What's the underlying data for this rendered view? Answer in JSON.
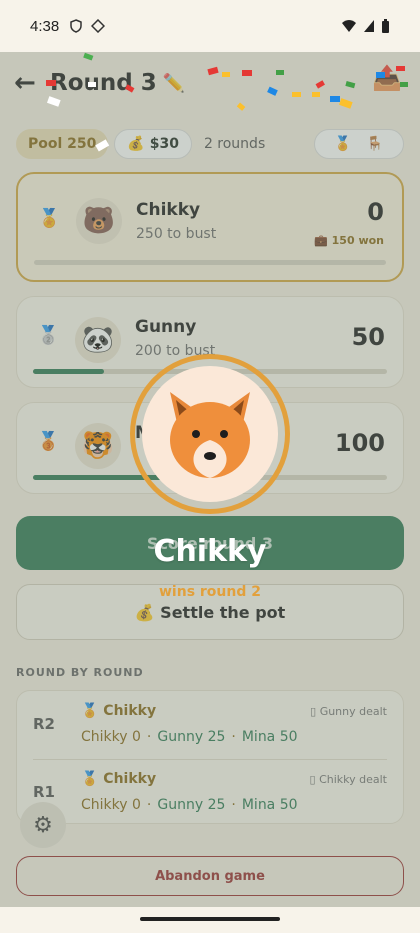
{
  "status": {
    "time": "4:38"
  },
  "header": {
    "back_icon": "arrow-left-icon",
    "title": "Round 3",
    "pencil": "✏️",
    "shelf_icon": "📤"
  },
  "chips": {
    "pool": "Pool 250",
    "money": "💰 $30",
    "rounds": "2 rounds",
    "icon_a": "🏅",
    "icon_b": "🪑"
  },
  "players": [
    {
      "medal": "🏅",
      "avatar": "🐻",
      "name": "Chikky",
      "bust": "250 to bust",
      "score": "0",
      "won": "150 won",
      "progress": 0.0
    },
    {
      "medal": "🥈",
      "avatar": "🐼",
      "name": "Gunny",
      "bust": "200 to bust",
      "score": "50",
      "progress": 0.2
    },
    {
      "medal": "🥉",
      "avatar": "🐯",
      "name": "M",
      "bust": "",
      "score": "100",
      "progress": 0.4
    }
  ],
  "actions": {
    "score_round": "Score round 3",
    "settle": "💰 Settle the pot",
    "abandon": "Abandon game"
  },
  "history": {
    "section_label": "ROUND BY ROUND",
    "rows": [
      {
        "round": "R2",
        "winner": "🏅 Chikky",
        "dealt": "Gunny dealt",
        "s1": "Chikky 0",
        "s2": "Gunny 25",
        "s3": "Mina 50"
      },
      {
        "round": "R1",
        "winner": "🏅 Chikky",
        "dealt": "Chikky dealt",
        "s1": "Chikky 0",
        "s2": "Gunny 25",
        "s3": "Mina 50"
      }
    ]
  },
  "celebration": {
    "name": "Chikky",
    "subtitle": "wins round 2"
  },
  "colors": {
    "accent": "#2f7a55",
    "gold": "#e2a03c",
    "danger": "#9b2f2f"
  }
}
